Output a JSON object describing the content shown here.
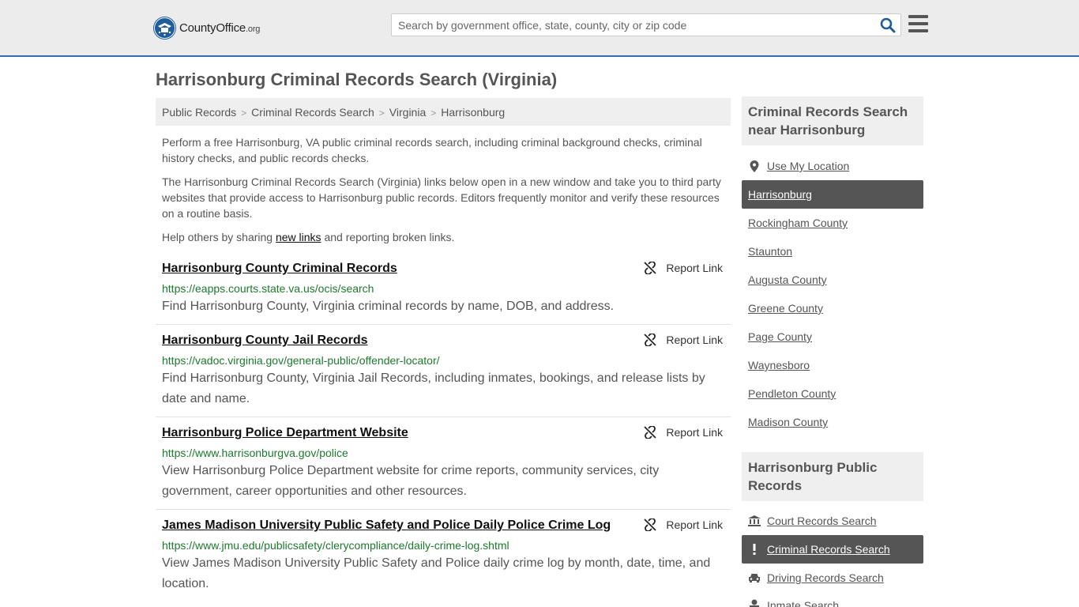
{
  "header": {
    "logo_text": "CountyOffice",
    "logo_suffix": ".org",
    "search_placeholder": "Search by government office, state, county, city or zip code"
  },
  "page_title": "Harrisonburg Criminal Records Search (Virginia)",
  "breadcrumb": [
    "Public Records",
    "Criminal Records Search",
    "Virginia",
    "Harrisonburg"
  ],
  "intro": {
    "p1": "Perform a free Harrisonburg, VA public criminal records search, including criminal background checks, criminal history checks, and public records checks.",
    "p2": "The Harrisonburg Criminal Records Search (Virginia) links below open in a new window and take you to third party websites that provide access to Harrisonburg public records. Editors frequently monitor and verify these resources on a routine basis.",
    "p3_before": "Help others by sharing ",
    "p3_link": "new links",
    "p3_after": " and reporting broken links."
  },
  "report_label": "Report Link",
  "results": [
    {
      "title": "Harrisonburg County Criminal Records",
      "url": "https://eapps.courts.state.va.us/ocis/search",
      "desc": "Find Harrisonburg County, Virginia criminal records by name, DOB, and address."
    },
    {
      "title": "Harrisonburg County Jail Records",
      "url": "https://vadoc.virginia.gov/general-public/offender-locator/",
      "desc": "Find Harrisonburg County, Virginia Jail Records, including inmates, bookings, and release lists by date and name."
    },
    {
      "title": "Harrisonburg Police Department Website",
      "url": "https://www.harrisonburgva.gov/police",
      "desc": "View Harrisonburg Police Department website for crime reports, community services, city government, career opportunities and other resources."
    },
    {
      "title": "James Madison University Public Safety and Police Daily Police Crime Log",
      "url": "https://www.jmu.edu/publicsafety/clerycompliance/daily-crime-log.shtml",
      "desc": "View James Madison University Public Safety and Police daily crime log by month, date, time, and location."
    }
  ],
  "sidebar": {
    "nearby_heading": "Criminal Records Search near Harrisonburg",
    "use_location": "Use My Location",
    "nearby": [
      "Harrisonburg",
      "Rockingham County",
      "Staunton",
      "Augusta County",
      "Greene County",
      "Page County",
      "Waynesboro",
      "Pendleton County",
      "Madison County"
    ],
    "public_heading": "Harrisonburg Public Records",
    "public": [
      {
        "label": "Court Records Search",
        "icon": "courthouse-icon"
      },
      {
        "label": "Criminal Records Search",
        "icon": "exclamation-icon"
      },
      {
        "label": "Driving Records Search",
        "icon": "car-icon"
      },
      {
        "label": "Inmate Search",
        "icon": "inmate-icon"
      }
    ]
  }
}
